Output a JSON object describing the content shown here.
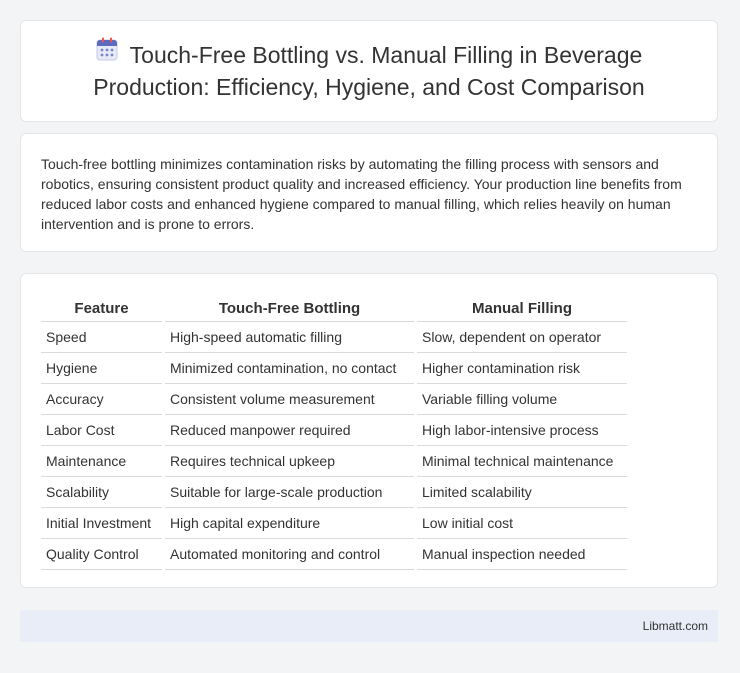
{
  "header": {
    "title_line1": "Touch-Free Bottling vs. Manual Filling in Beverage",
    "title_line2": "Production: Efficiency, Hygiene, and Cost Comparison",
    "icon": "calendar-icon"
  },
  "intro": {
    "text": "Touch-free bottling minimizes contamination risks by automating the filling process with sensors and robotics, ensuring consistent product quality and increased efficiency. Your production line benefits from reduced labor costs and enhanced hygiene compared to manual filling, which relies heavily on human intervention and is prone to errors."
  },
  "table": {
    "headers": [
      "Feature",
      "Touch-Free Bottling",
      "Manual Filling"
    ],
    "rows": [
      [
        "Speed",
        "High-speed automatic filling",
        "Slow, dependent on operator"
      ],
      [
        "Hygiene",
        "Minimized contamination, no contact",
        "Higher contamination risk"
      ],
      [
        "Accuracy",
        "Consistent volume measurement",
        "Variable filling volume"
      ],
      [
        "Labor Cost",
        "Reduced manpower required",
        "High labor-intensive process"
      ],
      [
        "Maintenance",
        "Requires technical upkeep",
        "Minimal technical maintenance"
      ],
      [
        "Scalability",
        "Suitable for large-scale production",
        "Limited scalability"
      ],
      [
        "Initial Investment",
        "High capital expenditure",
        "Low initial cost"
      ],
      [
        "Quality Control",
        "Automated monitoring and control",
        "Manual inspection needed"
      ]
    ]
  },
  "footer": {
    "brand": "Libmatt.com"
  }
}
